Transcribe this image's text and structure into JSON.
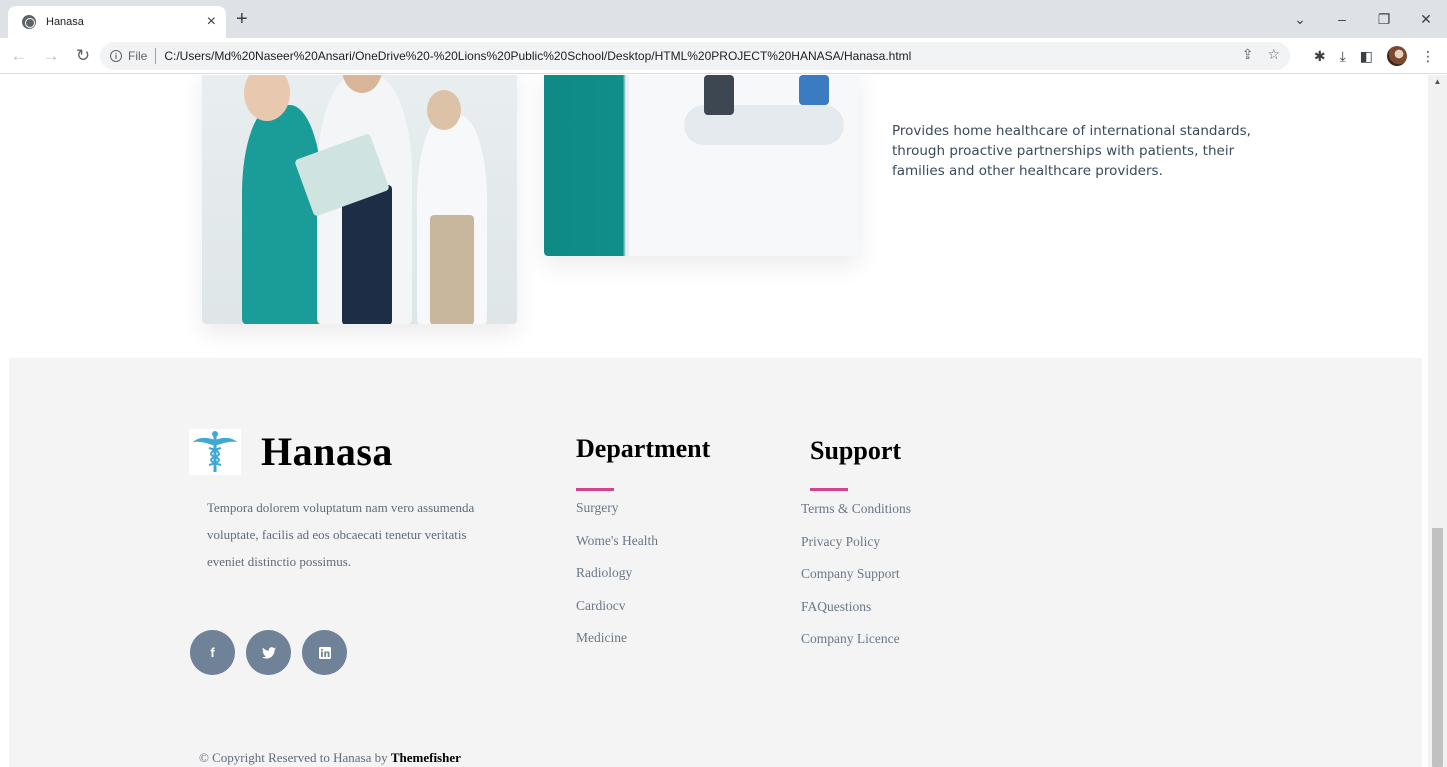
{
  "browser": {
    "tab_title": "Hanasa",
    "tab_close": "×",
    "new_tab": "+",
    "win_min": "–",
    "win_restore": "❐",
    "win_close": "✕",
    "win_dropdown": "⌄",
    "url_scheme": "File",
    "url": "C:/Users/Md%20Naseer%20Ansari/OneDrive%20-%20Lions%20Public%20School/Desktop/HTML%20PROJECT%20HANASA/Hanasa.html"
  },
  "intro": {
    "text": "Provides home healthcare of international standards, through proactive partnerships with patients, their families and other healthcare providers."
  },
  "footer": {
    "brand_name": "Hanasa",
    "about": "Tempora dolorem voluptatum nam vero assumenda voluptate, facilis ad eos obcaecati tenetur veritatis eveniet distinctio possimus.",
    "socials": [
      {
        "icon": "facebook-icon",
        "glyph": "f"
      },
      {
        "icon": "twitter-icon",
        "glyph": "🐦"
      },
      {
        "icon": "linkedin-icon",
        "glyph": "in"
      }
    ],
    "department": {
      "title": "Department",
      "items": [
        "Surgery",
        "Wome's Health",
        "Radiology",
        "Cardiocv",
        "Medicine"
      ]
    },
    "support": {
      "title": "Support",
      "items": [
        "Terms & Conditions",
        "Privacy Policy",
        "Company Support",
        "FAQuestions",
        "Company Licence"
      ]
    },
    "copyright_prefix": "© Copyright Reserved to Hanasa by",
    "copyright_author": "Themefisher"
  },
  "colors": {
    "accent_bar": "#d6428c",
    "social_bg": "#6f8297",
    "footer_bg": "#f4f4f5",
    "logo_blue": "#3fa9d6"
  }
}
